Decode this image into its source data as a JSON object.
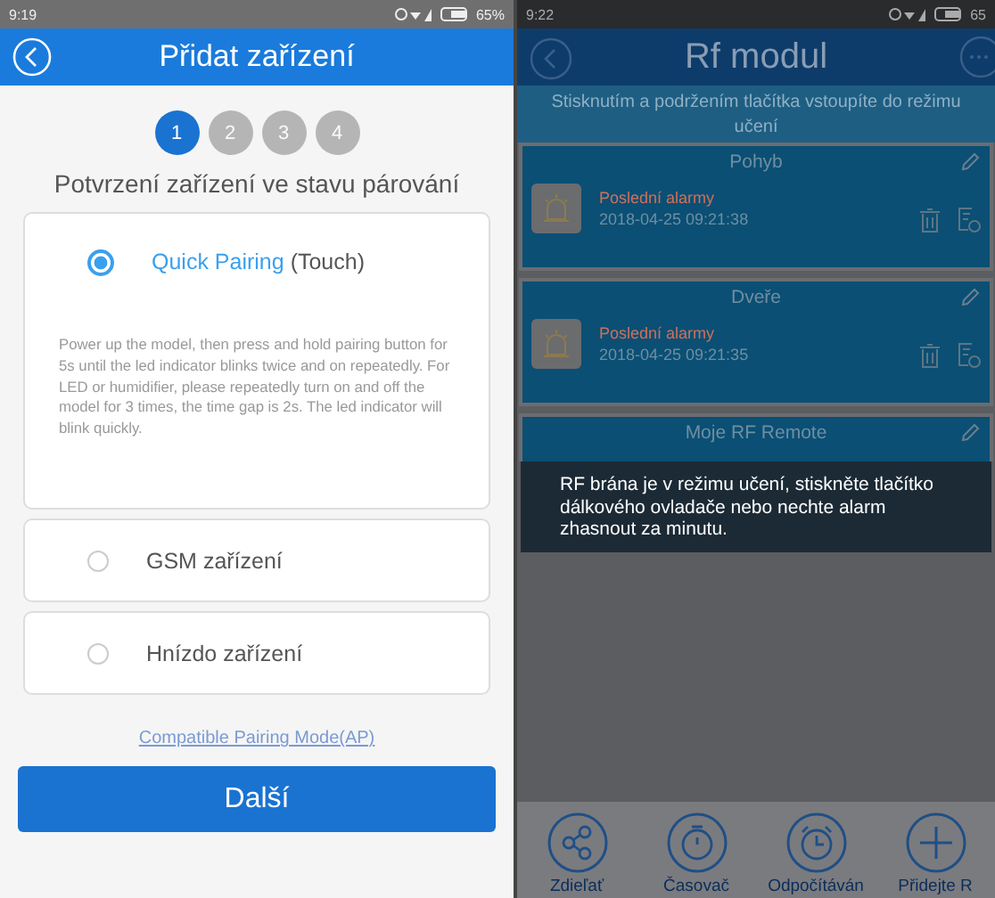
{
  "left": {
    "status_bar": {
      "time": "9:19",
      "battery": "65%"
    },
    "header": {
      "title": "Přidat zařízení"
    },
    "steps": [
      {
        "label": "1",
        "selected": true
      },
      {
        "label": "2",
        "selected": false
      },
      {
        "label": "3",
        "selected": false
      },
      {
        "label": "4",
        "selected": false
      }
    ],
    "subtitle": "Potvrzení zařízení ve stavu párování",
    "options": [
      {
        "label": "Quick Pairing",
        "suffix": "(Touch)",
        "selected": true,
        "description": "Power up the model, then press and hold pairing button for 5s until the led indicator blinks twice and on repeatedly. For LED or humidifier, please repeatedly turn on and off the model for 3 times, the time gap is 2s. The led indicator will blink quickly."
      },
      {
        "label": "GSM zařízení",
        "selected": false
      },
      {
        "label": "Hnízdo zařízení",
        "selected": false
      }
    ],
    "link": "Compatible Pairing Mode(AP)",
    "button": "Další"
  },
  "right": {
    "status_bar": {
      "time": "9:22",
      "battery": "65"
    },
    "header": {
      "title": "Rf modul"
    },
    "banner": "Stisknutím a podržením tlačítka vstoupíte do režimu učení",
    "devices": [
      {
        "name": "Pohyb",
        "status": "Poslední alarmy",
        "time": "2018-04-25 09:21:38"
      },
      {
        "name": "Dveře",
        "status": "Poslední alarmy",
        "time": "2018-04-25 09:21:35"
      },
      {
        "name": "Moje RF Remote"
      }
    ],
    "toast": "RF brána je v režimu učení, stiskněte tlačítko dálkového ovladače nebo nechte alarm zhasnout za minutu.",
    "toolbar": [
      {
        "kind": "share",
        "label": "Zdieľať"
      },
      {
        "kind": "timer",
        "label": "Časovač"
      },
      {
        "kind": "alarm",
        "label": "Odpočítáván"
      },
      {
        "kind": "add",
        "label": "Přidejte R"
      }
    ]
  }
}
